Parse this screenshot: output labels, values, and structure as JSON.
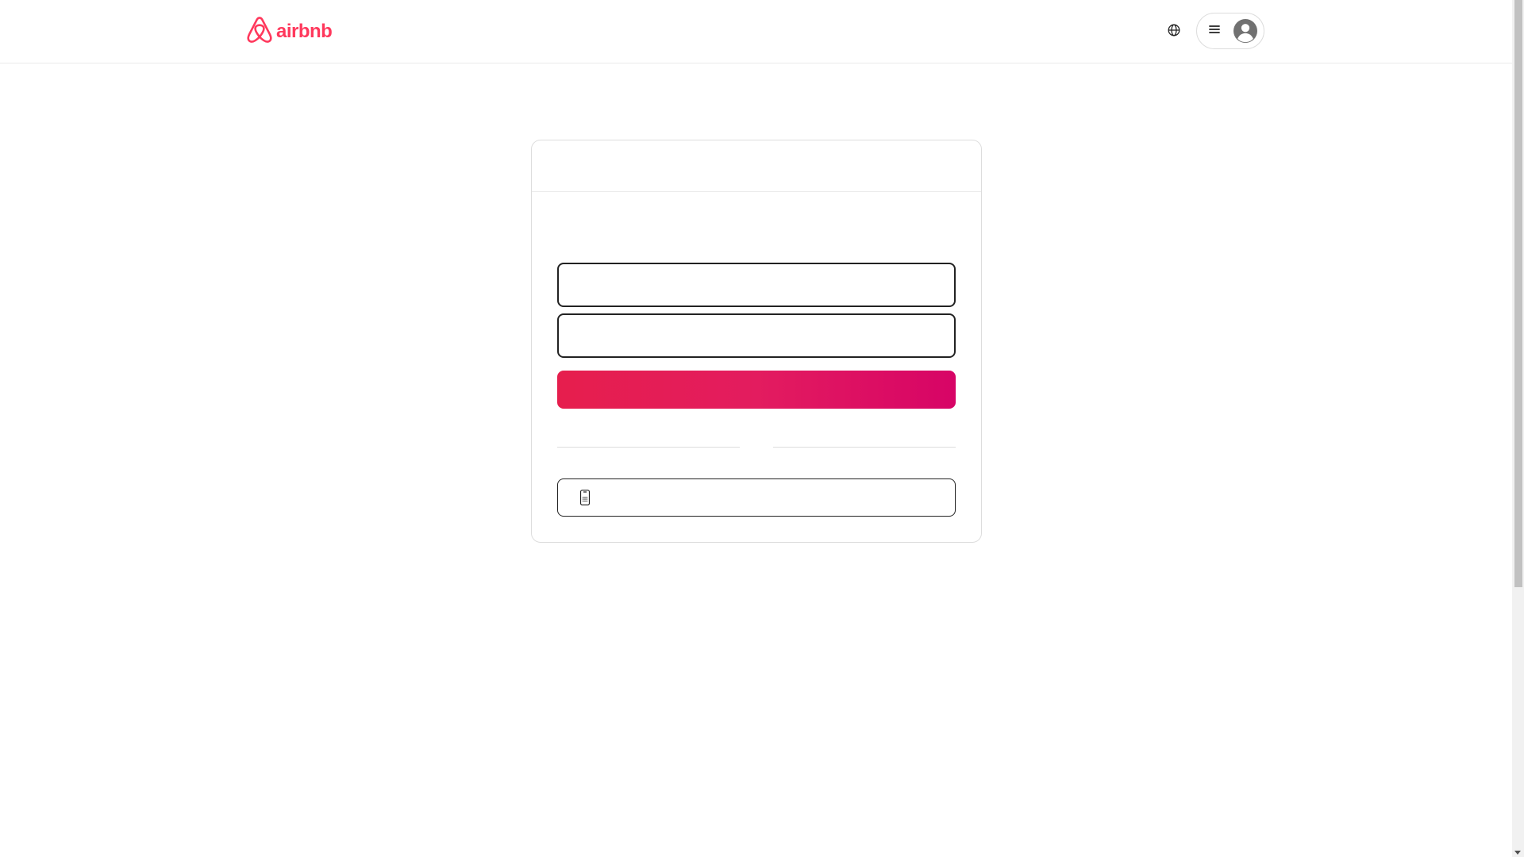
{
  "header": {
    "logo_text": "airbnb",
    "brand_color": "#ff385c",
    "icons": {
      "logo": "airbnb-belo-icon",
      "language": "globe-icon",
      "menu": "hamburger-icon",
      "avatar": "user-avatar-icon"
    }
  },
  "login_card": {
    "header_title": "",
    "title": "",
    "email_field": {
      "value": "",
      "placeholder": ""
    },
    "password_field": {
      "value": "",
      "placeholder": ""
    },
    "continue_button_label": "",
    "continue_button_colors": [
      "#e61e4d",
      "#e31c5f",
      "#d70466"
    ],
    "divider_text": "",
    "phone_button": {
      "label": "",
      "icon": "mobile-phone-icon"
    }
  }
}
